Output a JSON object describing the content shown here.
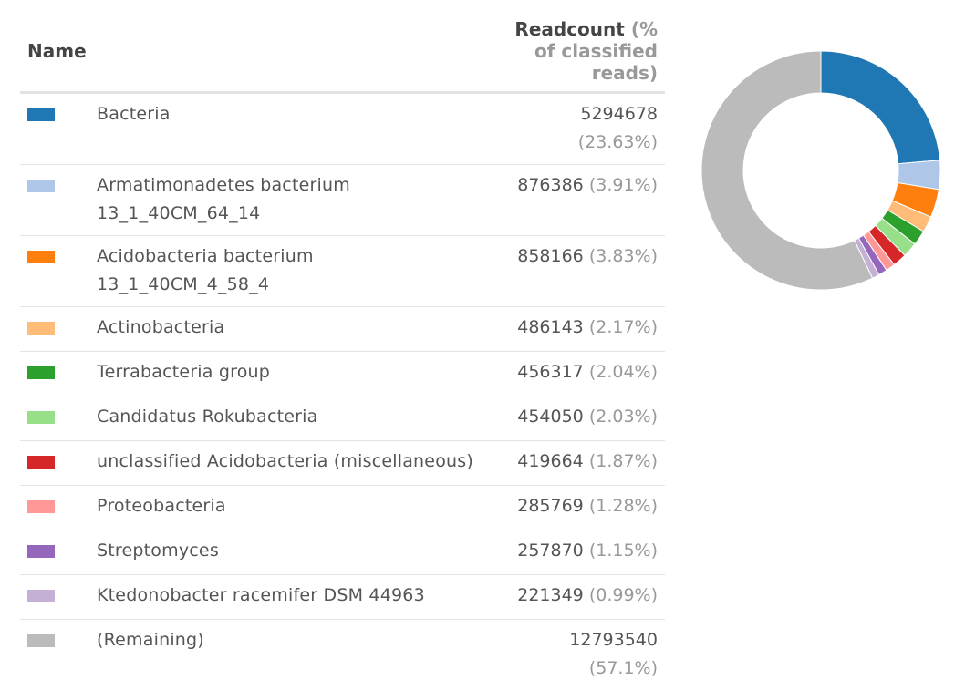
{
  "header": {
    "name": "Name",
    "readcount": "Readcount",
    "pct_label": "(% of classified reads)"
  },
  "chart_data": {
    "type": "pie",
    "donut": true,
    "categories": [
      "Bacteria",
      "Armatimonadetes bacterium 13_1_40CM_64_14",
      "Acidobacteria bacterium 13_1_40CM_4_58_4",
      "Actinobacteria",
      "Terrabacteria group",
      "Candidatus Rokubacteria",
      "unclassified Acidobacteria (miscellaneous)",
      "Proteobacteria",
      "Streptomyces",
      "Ktedonobacter racemifer DSM 44963",
      "(Remaining)"
    ],
    "values": [
      5294678,
      876386,
      858166,
      486143,
      456317,
      454050,
      419664,
      285769,
      257870,
      221349,
      12793540
    ],
    "colors": [
      "#1f77b4",
      "#aec7e8",
      "#ff7f0e",
      "#ffbb78",
      "#2ca02c",
      "#98df8a",
      "#d62728",
      "#ff9896",
      "#9467bd",
      "#c5b0d5",
      "#bbbbbb"
    ]
  },
  "rows": [
    {
      "name": "Bacteria",
      "count": "5294678",
      "pct": "(23.63%)",
      "wrap": true
    },
    {
      "name": "Armatimonadetes bacterium 13_1_40CM_64_14",
      "count": "876386",
      "pct": "(3.91%)"
    },
    {
      "name": "Acidobacteria bacterium 13_1_40CM_4_58_4",
      "count": "858166",
      "pct": "(3.83%)"
    },
    {
      "name": "Actinobacteria",
      "count": "486143",
      "pct": "(2.17%)"
    },
    {
      "name": "Terrabacteria group",
      "count": "456317",
      "pct": "(2.04%)"
    },
    {
      "name": "Candidatus Rokubacteria",
      "count": "454050",
      "pct": "(2.03%)"
    },
    {
      "name": "unclassified Acidobacteria (miscellaneous)",
      "count": "419664",
      "pct": "(1.87%)"
    },
    {
      "name": "Proteobacteria",
      "count": "285769",
      "pct": "(1.28%)"
    },
    {
      "name": "Streptomyces",
      "count": "257870",
      "pct": "(1.15%)"
    },
    {
      "name": "Ktedonobacter racemifer DSM 44963",
      "count": "221349",
      "pct": "(0.99%)"
    },
    {
      "name": "(Remaining)",
      "count": "12793540",
      "pct": "(57.1%)",
      "wrap": true
    }
  ]
}
